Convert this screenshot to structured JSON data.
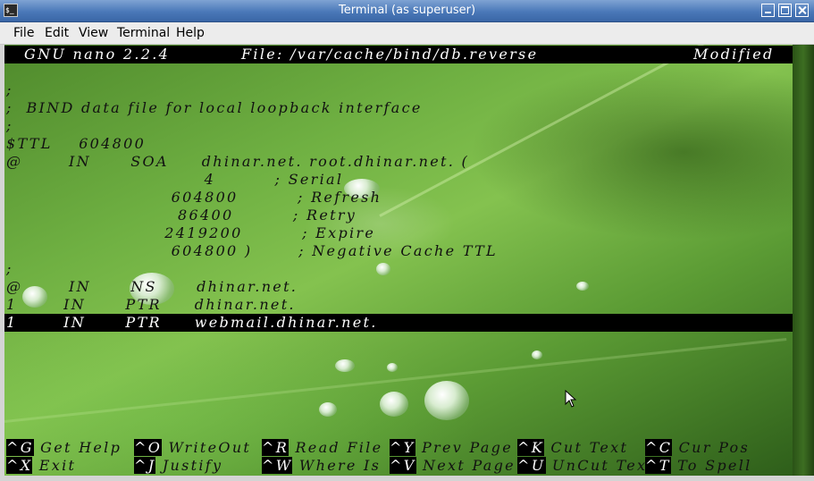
{
  "window": {
    "title": "Terminal (as superuser)",
    "app_icon": "terminal-icon"
  },
  "menu": {
    "file": "File",
    "edit": "Edit",
    "view": "View",
    "terminal": "Terminal",
    "help": "Help"
  },
  "nano": {
    "version": "GNU nano 2.2.4",
    "file": "File: /var/cache/bind/db.reverse",
    "status": "Modified"
  },
  "lines": [
    ";",
    ";  BIND data file for local loopback interface",
    ";",
    "$TTL    604800",
    "@       IN      SOA     dhinar.net. root.dhinar.net. (",
    "                              4         ; Serial",
    "                         604800         ; Refresh",
    "                          86400         ; Retry",
    "                        2419200         ; Expire",
    "                         604800 )       ; Negative Cache TTL",
    ";",
    "@       IN      NS      dhinar.net.",
    "1       IN      PTR     dhinar.net.",
    "1       IN      PTR     webmail.dhinar.net."
  ],
  "shortcuts_row1": [
    {
      "key": "^G",
      "label": " Get Help"
    },
    {
      "key": "^O",
      "label": " WriteOut"
    },
    {
      "key": "^R",
      "label": " Read File"
    },
    {
      "key": "^Y",
      "label": " Prev Page"
    },
    {
      "key": "^K",
      "label": " Cut Text"
    },
    {
      "key": "^C",
      "label": " Cur Pos"
    }
  ],
  "shortcuts_row2": [
    {
      "key": "^X",
      "label": " Exit"
    },
    {
      "key": "^J",
      "label": " Justify"
    },
    {
      "key": "^W",
      "label": " Where Is"
    },
    {
      "key": "^V",
      "label": " Next Page"
    },
    {
      "key": "^U",
      "label": " UnCut Text"
    },
    {
      "key": "^T",
      "label": " To Spell"
    }
  ]
}
